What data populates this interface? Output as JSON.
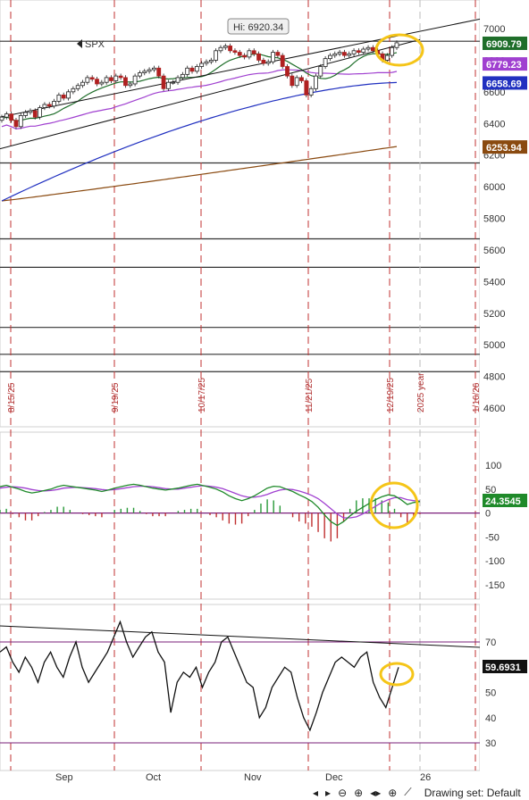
{
  "chart_data": [
    {
      "type": "candlestick",
      "symbol": "SPX",
      "hi_label": "Hi: 6920.34",
      "y_ticks": [
        "7000",
        "6800",
        "6600",
        "6400",
        "6200",
        "6000",
        "5800",
        "5600",
        "5400",
        "5200",
        "5000",
        "4800",
        "4600"
      ],
      "y_tick_values": [
        7000,
        6800,
        6600,
        6400,
        6200,
        6000,
        5800,
        5600,
        5400,
        5200,
        5000,
        4800,
        4600
      ],
      "ylim": [
        4500,
        7100
      ],
      "price_badges": [
        {
          "label": "6909.79",
          "value": 6909.79,
          "color": "#1f6e2a"
        },
        {
          "label": "6779.23",
          "value": 6779.23,
          "color": "#a040d0"
        },
        {
          "label": "6658.69",
          "value": 6658.69,
          "color": "#2030c0"
        },
        {
          "label": "6253.94",
          "value": 6253.94,
          "color": "#8a4a10"
        }
      ],
      "date_markers": [
        "8/15/25",
        "9/19/25",
        "10/17/25",
        "11/21/25",
        "12/19/25",
        "2025 year",
        "1/16/26"
      ],
      "horizontal_levels": [
        6920,
        6150,
        5670,
        5490,
        5110,
        4940,
        4830
      ],
      "close_series": [
        6440,
        6460,
        6420,
        6380,
        6450,
        6470,
        6480,
        6440,
        6500,
        6520,
        6510,
        6540,
        6580,
        6560,
        6600,
        6620,
        6640,
        6660,
        6690,
        6680,
        6650,
        6660,
        6690,
        6670,
        6700,
        6690,
        6640,
        6650,
        6700,
        6720,
        6730,
        6740,
        6750,
        6700,
        6620,
        6660,
        6660,
        6690,
        6710,
        6750,
        6730,
        6760,
        6780,
        6790,
        6800,
        6860,
        6880,
        6890,
        6860,
        6850,
        6830,
        6820,
        6860,
        6840,
        6800,
        6780,
        6790,
        6850,
        6830,
        6760,
        6700,
        6640,
        6690,
        6670,
        6580,
        6620,
        6700,
        6760,
        6810,
        6830,
        6840,
        6850,
        6830,
        6840,
        6860,
        6850,
        6870,
        6880,
        6860,
        6840,
        6800,
        6830,
        6880,
        6910
      ],
      "sma_20_last": 6779.23,
      "sma_50_last": 6658.69,
      "sma_200_last": 6253.94
    },
    {
      "type": "line",
      "name": "MACD",
      "y_ticks": [
        "100",
        "50",
        "0",
        "-50",
        "-100",
        "-150"
      ],
      "y_tick_values": [
        100,
        50,
        0,
        -50,
        -100,
        -150
      ],
      "ylim": [
        -175,
        115
      ],
      "last_value_label": "24.3545",
      "macd_series": [
        55,
        58,
        54,
        50,
        45,
        42,
        44,
        47,
        50,
        55,
        58,
        56,
        54,
        52,
        50,
        48,
        45,
        48,
        52,
        55,
        58,
        60,
        58,
        55,
        52,
        50,
        48,
        50,
        52,
        55,
        58,
        60,
        57,
        54,
        50,
        44,
        36,
        30,
        26,
        30,
        36,
        44,
        52,
        56,
        55,
        50,
        45,
        38,
        32,
        24,
        12,
        -4,
        -18,
        -26,
        -18,
        -6,
        4,
        12,
        20,
        28,
        34,
        38,
        36,
        28,
        18,
        22,
        24
      ],
      "signal_series": [
        52,
        54,
        55,
        54,
        52,
        49,
        47,
        46,
        47,
        49,
        52,
        53,
        54,
        53,
        52,
        51,
        49,
        48,
        49,
        51,
        53,
        55,
        56,
        56,
        55,
        53,
        51,
        50,
        50,
        52,
        54,
        56,
        57,
        56,
        54,
        51,
        46,
        41,
        36,
        33,
        33,
        35,
        39,
        44,
        48,
        50,
        49,
        46,
        42,
        37,
        30,
        20,
        9,
        -2,
        -10,
        -10,
        -8,
        -2,
        6,
        14,
        22,
        28,
        32,
        32,
        28,
        26,
        25
      ]
    },
    {
      "type": "line",
      "name": "RSI",
      "y_ticks": [
        "70",
        "60",
        "50",
        "40",
        "30"
      ],
      "y_tick_values": [
        70,
        60,
        50,
        40,
        30
      ],
      "ylim": [
        20,
        82
      ],
      "last_value_label": "59.6931",
      "rsi_series": [
        66,
        68,
        62,
        58,
        64,
        60,
        54,
        62,
        66,
        60,
        56,
        64,
        70,
        60,
        54,
        58,
        62,
        66,
        72,
        78,
        70,
        64,
        68,
        72,
        74,
        66,
        62,
        42,
        54,
        58,
        56,
        60,
        52,
        58,
        62,
        70,
        72,
        66,
        60,
        54,
        52,
        40,
        44,
        52,
        56,
        60,
        58,
        48,
        40,
        35,
        42,
        50,
        56,
        62,
        64,
        62,
        60,
        64,
        66,
        54,
        48,
        44,
        52,
        60
      ]
    }
  ],
  "x_axis": {
    "month_labels": [
      "Sep",
      "Oct",
      "Nov",
      "Dec",
      "26"
    ]
  },
  "toolbar": {
    "drawing_set_label": "Drawing set: Default"
  },
  "colors": {
    "up_candle": "#1f6e2a",
    "down_candle": "#b02020",
    "sma20": "#1f6e2a",
    "sma50": "#a040d0",
    "sma100": "#2030c0",
    "sma200": "#8a4a10",
    "highlight": "#f5c518",
    "date_marker": "#c03030"
  }
}
